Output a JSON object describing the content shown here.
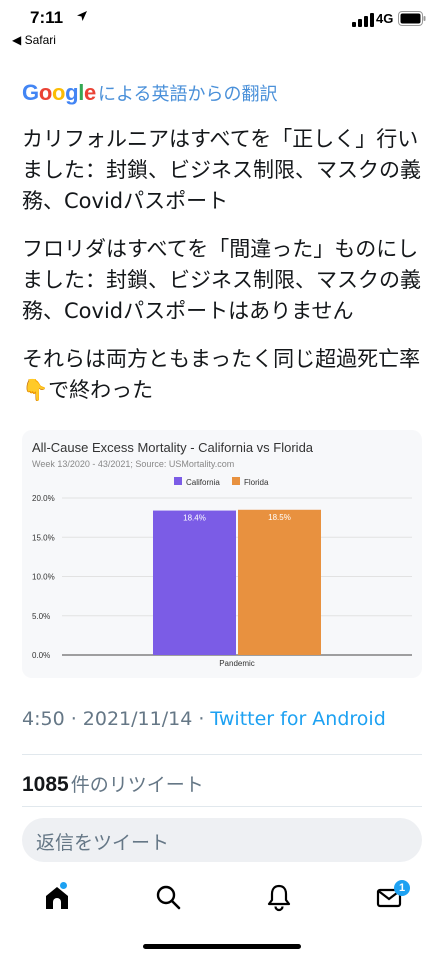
{
  "status_bar": {
    "time": "7:11",
    "back_app": "◀ Safari",
    "network": "4G"
  },
  "translation": {
    "google_letters": [
      {
        "ch": "G",
        "color": "#4285f4"
      },
      {
        "ch": "o",
        "color": "#ea4335"
      },
      {
        "ch": "o",
        "color": "#fbbc05"
      },
      {
        "ch": "g",
        "color": "#4285f4"
      },
      {
        "ch": "l",
        "color": "#34a853"
      },
      {
        "ch": "e",
        "color": "#ea4335"
      }
    ],
    "label": "による英語からの翻訳"
  },
  "tweet": {
    "paragraphs": [
      "カリフォルニアはすべてを「正しく」行いました：封鎖、ビジネス制限、マスクの義務、Covidパスポート",
      "フロリダはすべてを「間違った」ものにしました：封鎖、ビジネス制限、マスクの義務、Covidパスポートはありません",
      "それらは両方ともまったく同じ超過死亡率👇で終わった"
    ]
  },
  "chart_data": {
    "type": "bar",
    "title": "All-Cause Excess Mortality - California vs Florida",
    "subtitle": "Week 13/2020 - 43/2021; Source: USMortality.com",
    "categories": [
      "Pandemic"
    ],
    "series": [
      {
        "name": "California",
        "values": [
          18.4
        ],
        "label": "18.4%",
        "color": "#7b5ce6"
      },
      {
        "name": "Florida",
        "values": [
          18.5
        ],
        "label": "18.5%",
        "color": "#e8913f"
      }
    ],
    "yticks": [
      "20.0%",
      "15.0%",
      "10.0%",
      "5.0%",
      "0.0%"
    ],
    "ylim": [
      0,
      20
    ],
    "grid": true,
    "legend": "top"
  },
  "meta": {
    "time": "4:50 · 2021/11/14 · ",
    "via": "Twitter for Android"
  },
  "retweets": {
    "count": "1085",
    "label": "件のリツイート"
  },
  "reply": {
    "placeholder": "返信をツイート"
  },
  "tabs": {
    "messages_badge": "1"
  },
  "colors": {
    "link": "#1da1f2",
    "translate": "#4a90d9",
    "muted": "#657786"
  }
}
